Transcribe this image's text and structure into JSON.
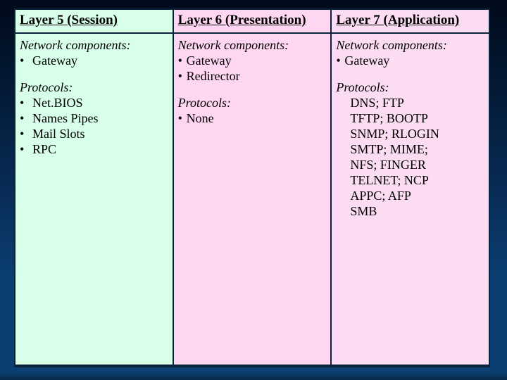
{
  "columns": [
    {
      "key": "session",
      "header": "Layer 5 (Session)",
      "components_label": "Network components:",
      "components": [
        "Gateway"
      ],
      "protocols_label": "Protocols:",
      "protocols": [
        "Net.BIOS",
        "Names Pipes",
        "Mail Slots",
        "RPC"
      ],
      "bullet_style": "wide"
    },
    {
      "key": "presentation",
      "header": "Layer 6 (Presentation)",
      "components_label": "Network components:",
      "components": [
        "Gateway",
        "Redirector"
      ],
      "protocols_label": "Protocols:",
      "protocols": [
        "None"
      ],
      "bullet_style": "tight"
    },
    {
      "key": "application",
      "header": "Layer 7 (Application)",
      "components_label": "Network components:",
      "components": [
        "Gateway"
      ],
      "protocols_label": "Protocols:",
      "protocols": [
        "DNS; FTP",
        "TFTP; BOOTP",
        "SNMP; RLOGIN",
        "SMTP; MIME;",
        "NFS; FINGER",
        "TELNET; NCP",
        "APPC; AFP",
        "SMB"
      ],
      "bullet_style": "indent"
    }
  ]
}
